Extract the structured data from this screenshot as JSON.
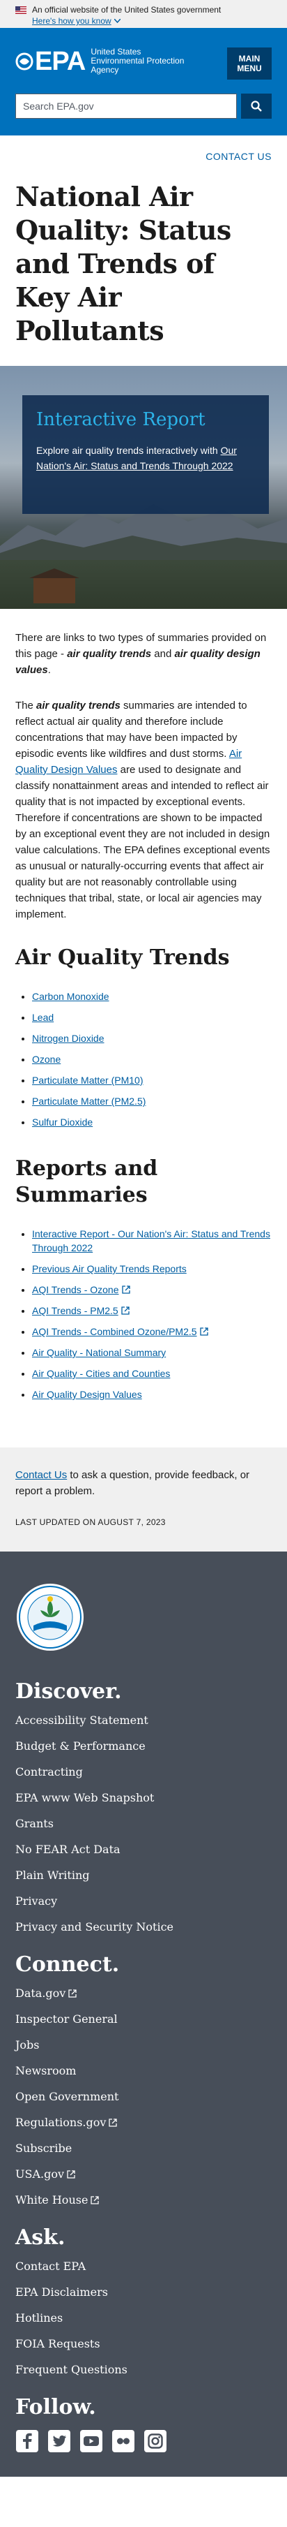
{
  "gov_banner": {
    "text": "An official website of the United States government",
    "link": "Here's how you know"
  },
  "header": {
    "logo_mark": "EPA",
    "logo_text_line1": "United States",
    "logo_text_line2": "Environmental Protection",
    "logo_text_line3": "Agency",
    "menu_line1": "MAIN",
    "menu_line2": "MENU",
    "search_placeholder": "Search EPA.gov"
  },
  "contact_us_top": "CONTACT US",
  "page_title": "National Air Quality: Status and Trends of Key Air Pollutants",
  "hero": {
    "title": "Interactive Report",
    "text_prefix": "Explore air quality trends interactively with ",
    "link": "Our Nation's Air: Status and Trends Through 2022"
  },
  "intro": {
    "p1_a": "There are links to two types of summaries provided on this page - ",
    "p1_b": "air quality trends",
    "p1_c": " and ",
    "p1_d": "air quality design values",
    "p1_e": ".",
    "p2_a": "The ",
    "p2_b": "air quality trends",
    "p2_c": " summaries are intended to reflect actual air quality and therefore include concentrations that may have been impacted by episodic events like wildfires and dust storms.  ",
    "p2_link": "Air Quality Design Values",
    "p2_d": " are used to designate and classify nonattainment areas and intended to reflect air quality that is not impacted by exceptional events. Therefore if concentrations are shown to be impacted by an exceptional event they are not included in design value calculations. The EPA defines exceptional events as unusual or naturally-occurring events that affect air quality but are not reasonably controllable using techniques that tribal, state, or local air agencies may implement."
  },
  "trends": {
    "heading": "Air Quality Trends",
    "items": [
      "Carbon Monoxide",
      "Lead",
      "Nitrogen Dioxide",
      "Ozone",
      "Particulate Matter (PM10)",
      "Particulate Matter (PM2.5)",
      "Sulfur Dioxide"
    ]
  },
  "reports": {
    "heading": "Reports and Summaries",
    "items": [
      {
        "label": "Interactive Report - Our Nation's Air: Status and Trends Through 2022"
      },
      {
        "label": "Previous Air Quality Trends Reports"
      },
      {
        "label": "AQI Trends - Ozone"
      },
      {
        "label": "AQI Trends - PM2.5"
      },
      {
        "label": "AQI Trends - Combined Ozone/PM2.5"
      },
      {
        "label": "Air Quality - National Summary"
      },
      {
        "label": "Air Quality - Cities and Counties"
      },
      {
        "label": "Air Quality Design Values"
      }
    ]
  },
  "contact_box": {
    "link": "Contact Us",
    "text": " to ask a question, provide feedback, or report a problem.",
    "updated": "LAST UPDATED ON AUGUST 7, 2023"
  },
  "footer": {
    "discover": {
      "heading": "Discover.",
      "items": [
        "Accessibility Statement",
        "Budget & Performance",
        "Contracting",
        "EPA www Web Snapshot",
        "Grants",
        "No FEAR Act Data",
        "Plain Writing",
        "Privacy",
        "Privacy and Security Notice"
      ]
    },
    "connect": {
      "heading": "Connect.",
      "items": [
        "Data.gov",
        "Inspector General",
        "Jobs",
        "Newsroom",
        "Open Government",
        "Regulations.gov",
        "Subscribe",
        "USA.gov",
        "White House"
      ]
    },
    "ask": {
      "heading": "Ask.",
      "items": [
        "Contact EPA",
        "EPA Disclaimers",
        "Hotlines",
        "FOIA Requests",
        "Frequent Questions"
      ]
    },
    "follow": {
      "heading": "Follow."
    }
  }
}
